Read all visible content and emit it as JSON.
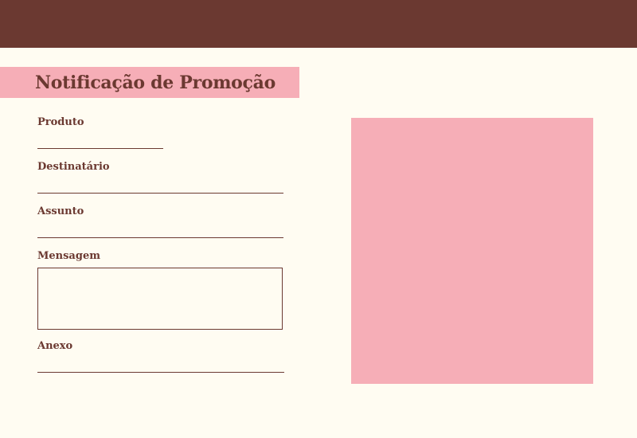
{
  "header": {
    "bar_color": "#6b3931"
  },
  "title": {
    "text": "Notificação de Promoção",
    "banner_color": "#f6aeb7"
  },
  "form": {
    "product": {
      "label": "Produto",
      "value": ""
    },
    "recipient": {
      "label": "Destinatário",
      "value": ""
    },
    "subject": {
      "label": "Assunto",
      "value": ""
    },
    "message": {
      "label": "Mensagem",
      "value": ""
    },
    "attachment": {
      "label": "Anexo",
      "value": ""
    }
  },
  "colors": {
    "background": "#fffcf2",
    "accent_dark": "#6b3931",
    "accent_pink": "#f6aeb7"
  }
}
